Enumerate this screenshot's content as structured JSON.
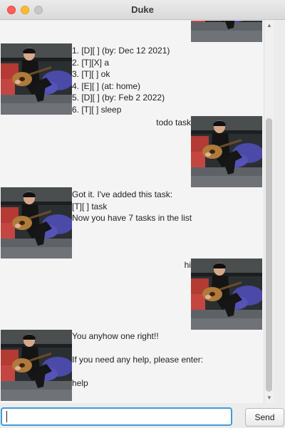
{
  "window": {
    "title": "Duke"
  },
  "conversation": {
    "list_reply": [
      "1. [D][ ] (by: Dec 12 2021)",
      "2. [T][X] a",
      "3. [T][ ] ok",
      "4. [E][ ] (at: home)",
      "5. [D][ ] (by: Feb 2 2022)",
      "6. [T][ ] sleep"
    ],
    "user_todo": "todo task",
    "added_reply": [
      "Got it. I've added this task:",
      "[T][ ] task",
      "Now you have 7 tasks in the list"
    ],
    "user_hi": "hi",
    "help_reply": [
      "You anyhow one right!!",
      "",
      "If you need any help, please enter:",
      "",
      "help"
    ]
  },
  "input": {
    "value": "",
    "placeholder": ""
  },
  "send_button": {
    "label": "Send"
  }
}
